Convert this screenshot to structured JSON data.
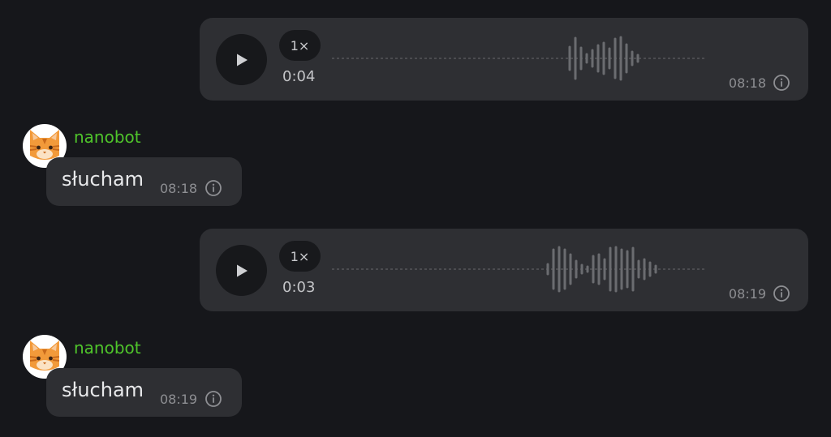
{
  "messages": [
    {
      "type": "voice",
      "direction": "outgoing",
      "speed_label": "1×",
      "duration": "0:04",
      "time": "08:18",
      "icons": {
        "play": "play-icon",
        "info": "info-icon"
      }
    },
    {
      "type": "text",
      "direction": "incoming",
      "sender": "nanobot",
      "avatar": "cat-avatar",
      "text": "słucham",
      "time": "08:18",
      "icons": {
        "info": "info-icon"
      }
    },
    {
      "type": "voice",
      "direction": "outgoing",
      "speed_label": "1×",
      "duration": "0:03",
      "time": "08:19",
      "icons": {
        "play": "play-icon",
        "info": "info-icon"
      }
    },
    {
      "type": "text",
      "direction": "incoming",
      "sender": "nanobot",
      "avatar": "cat-avatar",
      "text": "słucham",
      "time": "08:19",
      "icons": {
        "info": "info-icon"
      }
    }
  ],
  "colors": {
    "background": "#16171b",
    "bubble": "#2e2f33",
    "sender_name": "#4fc42b",
    "waveform": "#6b6c70",
    "meta_text": "#8e8f93"
  }
}
